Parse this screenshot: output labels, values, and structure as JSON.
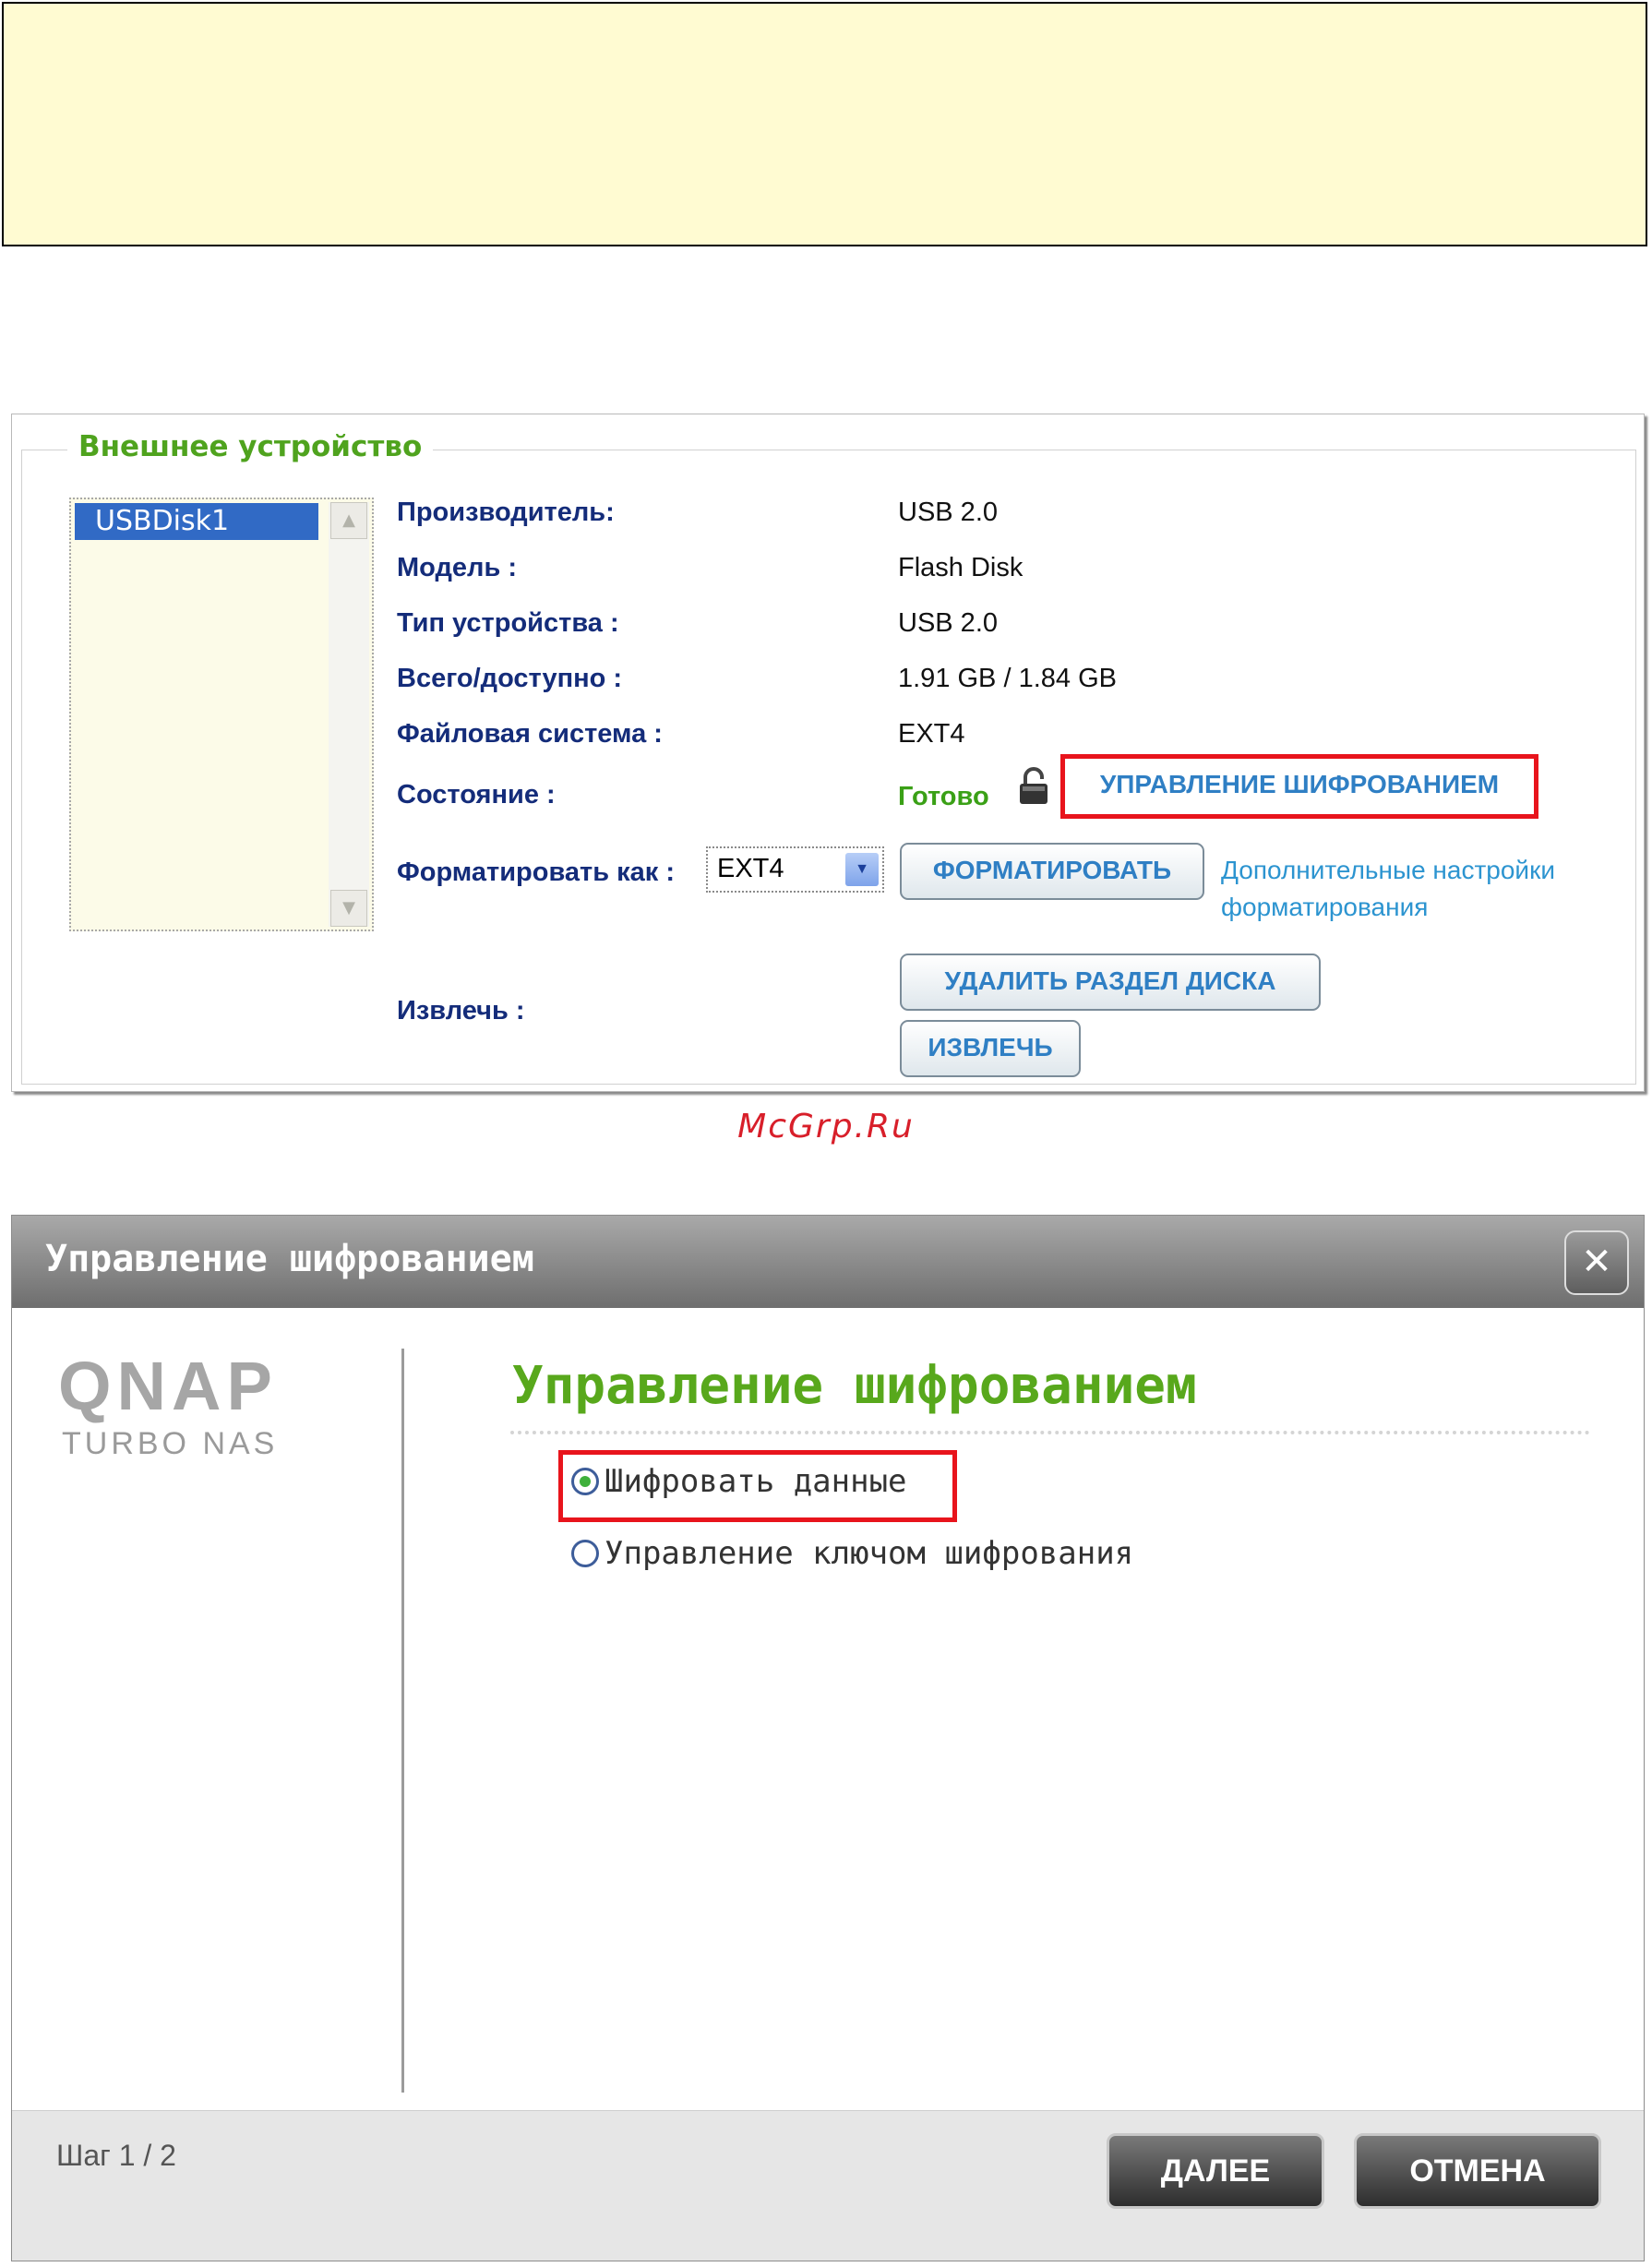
{
  "device": {
    "legend": "Внешнее устройство",
    "list_items": [
      "USBDisk1"
    ],
    "labels": {
      "manufacturer": "Производитель:",
      "model": "Модель :",
      "device_type": "Тип устройства :",
      "total_free": "Всего/доступно :",
      "filesystem": "Файловая система :",
      "status": "Состояние :",
      "format_as": "Форматировать как :",
      "eject": "Извлечь :"
    },
    "values": {
      "manufacturer": "USB 2.0",
      "model": "Flash Disk",
      "device_type": "USB 2.0",
      "total_free": "1.91 GB / 1.84 GB",
      "filesystem": "EXT4",
      "status": "Готово"
    },
    "format_select_value": "EXT4",
    "buttons": {
      "encryption_manage": "УПРАВЛЕНИЕ ШИФРОВАНИЕМ",
      "format": "ФОРМАТИРОВАТЬ",
      "delete_partition": "УДАЛИТЬ РАЗДЕЛ ДИСКА",
      "eject": "ИЗВЛЕЧЬ"
    },
    "advanced_format_link": "Дополнительные настройки форматирования"
  },
  "watermark": "McGrp.Ru",
  "dialog": {
    "title": "Управление шифрованием",
    "logo": "QNAP",
    "logo_sub": "TURBO NAS",
    "heading": "Управление шифрованием",
    "options": [
      {
        "label": "Шифровать данные",
        "selected": true
      },
      {
        "label": "Управление ключом шифрования",
        "selected": false
      }
    ],
    "step": "Шаг 1 / 2",
    "next_button": "ДАЛЕЕ",
    "cancel_button": "ОТМЕНА"
  },
  "colors": {
    "highlight": "#e8141c",
    "legend_green": "#4fa31e",
    "link_blue": "#2c94d0",
    "label_navy": "#142c7a",
    "note_box_bg": "#fffbd2"
  }
}
